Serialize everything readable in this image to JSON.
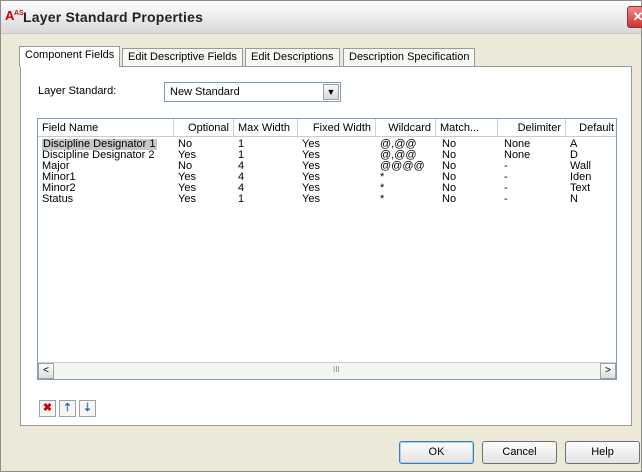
{
  "window": {
    "title": "Layer Standard Properties",
    "app_icon_text": "A"
  },
  "tabs": [
    {
      "label": "Component Fields",
      "active": true
    },
    {
      "label": "Edit Descriptive Fields",
      "active": false
    },
    {
      "label": "Edit Descriptions",
      "active": false
    },
    {
      "label": "Description Specification",
      "active": false
    }
  ],
  "layer_standard": {
    "label": "Layer Standard:",
    "value": "New Standard"
  },
  "table": {
    "columns": [
      "Field Name",
      "Optional",
      "Max Width",
      "Fixed Width",
      "Wildcard",
      "Match...",
      "Delimiter",
      "Default"
    ],
    "rows": [
      [
        "Discipline Designator 1",
        "No",
        "1",
        "Yes",
        "@,@@",
        "No",
        "None",
        "A"
      ],
      [
        "Discipline Designator 2",
        "Yes",
        "1",
        "Yes",
        "@,@@",
        "No",
        "None",
        "D"
      ],
      [
        "Major",
        "No",
        "4",
        "Yes",
        "@@@@",
        "No",
        "-",
        "Wall"
      ],
      [
        "Minor1",
        "Yes",
        "4",
        "Yes",
        "*",
        "No",
        "-",
        "Iden"
      ],
      [
        "Minor2",
        "Yes",
        "4",
        "Yes",
        "*",
        "No",
        "-",
        "Text"
      ],
      [
        "Status",
        "Yes",
        "1",
        "Yes",
        "*",
        "No",
        "-",
        "N"
      ]
    ]
  },
  "scrollbar": {
    "left": "<",
    "right": ">",
    "grip": "III"
  },
  "toolbar": {
    "delete_icon": "delete-icon",
    "move_up_icon": "move-up-icon",
    "move_down_icon": "move-down-icon"
  },
  "buttons": {
    "ok": "OK",
    "cancel": "Cancel",
    "help": "Help"
  },
  "colors": {
    "accent_close": "#c33333",
    "select_highlight": "#c8c8c8"
  }
}
